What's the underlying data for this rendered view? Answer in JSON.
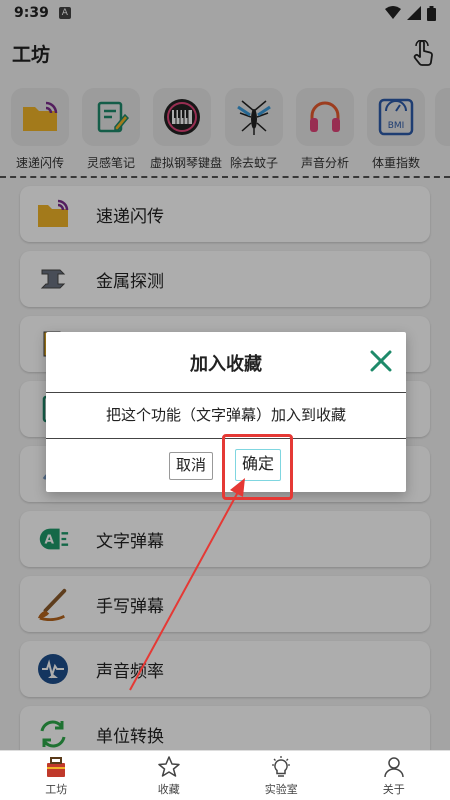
{
  "status": {
    "time": "9:39",
    "notification": "A"
  },
  "header": {
    "title": "工坊"
  },
  "quick_tools": [
    {
      "label": "速递闪传",
      "icon": "folder-wifi-icon"
    },
    {
      "label": "灵感笔记",
      "icon": "note-pencil-icon"
    },
    {
      "label": "虚拟钢琴键盘",
      "icon": "piano-icon"
    },
    {
      "label": "除去蚊子",
      "icon": "mosquito-icon"
    },
    {
      "label": "声音分析",
      "icon": "headphones-icon"
    },
    {
      "label": "体重指数",
      "icon": "bmi-scale-icon"
    }
  ],
  "quick_bmi_text": "BMI",
  "list": [
    {
      "label": "速递闪传"
    },
    {
      "label": "金属探测"
    },
    {
      "label": ""
    },
    {
      "label": ""
    },
    {
      "label": ""
    },
    {
      "label": "文字弹幕"
    },
    {
      "label": "手写弹幕"
    },
    {
      "label": "声音频率"
    },
    {
      "label": "单位转换"
    }
  ],
  "dialog": {
    "title": "加入收藏",
    "message": "把这个功能（文字弹幕）加入到收藏",
    "cancel": "取消",
    "confirm": "确定"
  },
  "tabs": [
    {
      "label": "工坊"
    },
    {
      "label": "收藏"
    },
    {
      "label": "实验室"
    },
    {
      "label": "关于"
    }
  ],
  "colors": {
    "accent": "#1e8a6a",
    "annotation": "#e53935",
    "folder": "#f0b429"
  }
}
